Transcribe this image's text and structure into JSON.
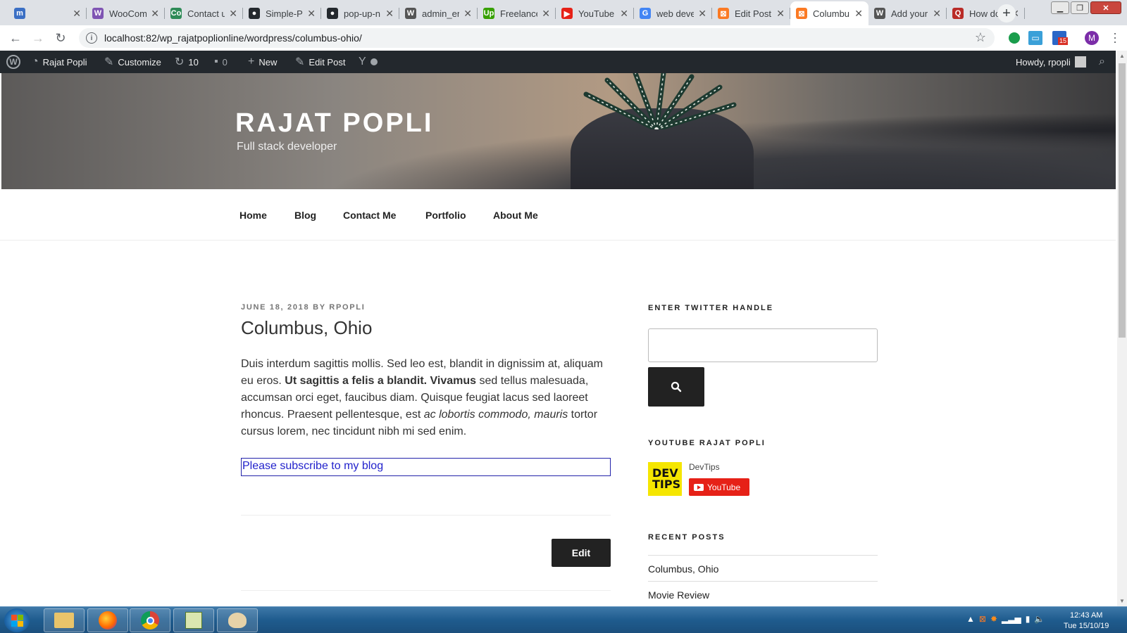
{
  "browser": {
    "tabs": [
      {
        "title": "",
        "icon": "m-icon",
        "color": "#3b6fc4",
        "glyph": "m"
      },
      {
        "title": "WooCom",
        "icon": "woocommerce-icon",
        "color": "#7f54b3",
        "glyph": "W"
      },
      {
        "title": "Contact u",
        "icon": "contact-icon",
        "color": "#2e8b57",
        "glyph": "Co"
      },
      {
        "title": "Simple-P",
        "icon": "github-icon",
        "color": "#24292e",
        "glyph": "●"
      },
      {
        "title": "pop-up-n",
        "icon": "github-icon",
        "color": "#24292e",
        "glyph": "●"
      },
      {
        "title": "admin_er",
        "icon": "wordpress-icon",
        "color": "#555",
        "glyph": "W"
      },
      {
        "title": "Freelance",
        "icon": "upwork-icon",
        "color": "#37a000",
        "glyph": "Up"
      },
      {
        "title": "YouTube",
        "icon": "youtube-icon",
        "color": "#e62117",
        "glyph": "▶"
      },
      {
        "title": "web deve",
        "icon": "google-icon",
        "color": "#4285f4",
        "glyph": "G"
      },
      {
        "title": "Edit Post",
        "icon": "xampp-icon",
        "color": "#fb7a24",
        "glyph": "⊠"
      },
      {
        "title": "Columbu",
        "icon": "xampp-icon",
        "color": "#fb7a24",
        "glyph": "⊠",
        "active": true
      },
      {
        "title": "Add your",
        "icon": "wordpress-icon",
        "color": "#555",
        "glyph": "W"
      },
      {
        "title": "How do I",
        "icon": "quora-icon",
        "color": "#b92b27",
        "glyph": "Q"
      }
    ],
    "url": "localhost:82/wp_rajatpoplionline/wordpress/columbus-ohio/",
    "profile_initial": "M",
    "calendar_badge": "15"
  },
  "admin_bar": {
    "site_name": "Rajat Popli",
    "customize": "Customize",
    "updates_count": "10",
    "comments_count": "0",
    "new_label": "New",
    "edit_post": "Edit Post",
    "howdy": "Howdy, rpopli"
  },
  "site": {
    "title": "RAJAT POPLI",
    "description": "Full stack developer"
  },
  "nav": [
    "Home",
    "Blog",
    "Contact Me",
    "Portfolio",
    "About Me"
  ],
  "post": {
    "meta": "JUNE 18, 2018 BY RPOPLI",
    "title": "Columbus, Ohio",
    "body_1": "Duis interdum sagittis mollis. Sed leo est, blandit in dignissim at, aliquam eu eros. ",
    "body_bold": "Ut sagittis a felis a blandit. Vivamus",
    "body_2": " sed tellus malesuada, accumsan orci eget, faucibus diam. Quisque feugiat lacus sed laoreet rhoncus. Praesent pellentesque, est ",
    "body_italic": "ac lobortis commodo, mauris",
    "body_3": " tortor cursus lorem, nec tincidunt nibh mi sed enim.",
    "subscribe": "Please subscribe to my blog",
    "edit": "Edit"
  },
  "sidebar": {
    "twitter_heading": "ENTER TWITTER HANDLE",
    "youtube_heading": "YOUTUBE RAJAT POPLI",
    "channel_logo": "DEV TIPS",
    "channel_name": "DevTips",
    "youtube_button": "YouTube",
    "recent_heading": "RECENT POSTS",
    "recent_posts": [
      "Columbus, Ohio",
      "Movie Review"
    ]
  },
  "taskbar": {
    "time": "12:43 AM",
    "date": "Tue 15/10/19"
  }
}
